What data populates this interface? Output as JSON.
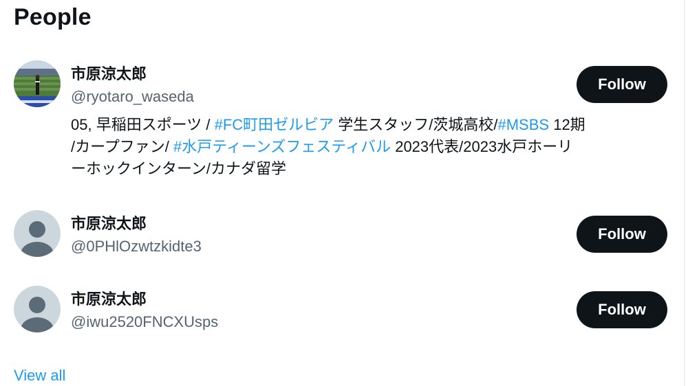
{
  "section": {
    "title": "People",
    "view_all_label": "View all"
  },
  "people": [
    {
      "name": "市原涼太郎",
      "handle": "@ryotaro_waseda",
      "follow_label": "Follow",
      "avatar": "photo-avatar",
      "bio": {
        "line1": [
          {
            "text": "05, 早稲田スポーツ / "
          },
          {
            "text": "#FC町田ゼルビア",
            "link": true
          },
          {
            "text": " 学生スタッフ/茨城高校/"
          },
          {
            "text": "#MSBS",
            "link": true
          },
          {
            "text": " 12期"
          }
        ],
        "line2": [
          {
            "text": "/カープファン/ "
          },
          {
            "text": "#水戸ティーンズフェスティバル",
            "link": true
          },
          {
            "text": " 2023代表/2023水戸ホーリ"
          }
        ],
        "line3": [
          {
            "text": "ーホックインターン/カナダ留学"
          }
        ]
      }
    },
    {
      "name": "市原涼太郎",
      "handle": "@0PHlOzwtzkidte3",
      "follow_label": "Follow",
      "avatar": "default-avatar"
    },
    {
      "name": "市原涼太郎",
      "handle": "@iwu2520FNCXUsps",
      "follow_label": "Follow",
      "avatar": "default-avatar"
    }
  ],
  "colors": {
    "link": "#1d9bf0",
    "button_bg": "#0f1419",
    "secondary_text": "#536471"
  }
}
